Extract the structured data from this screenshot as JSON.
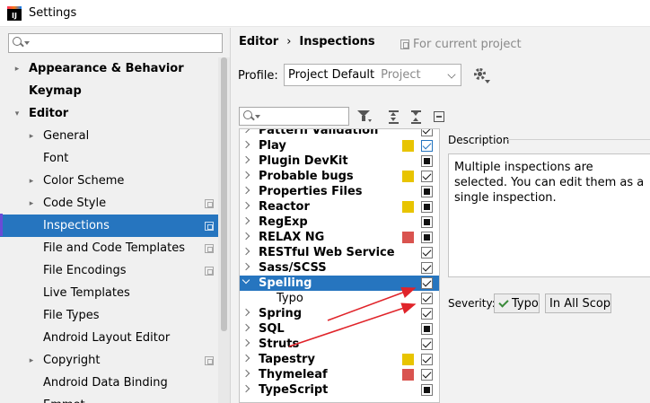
{
  "window": {
    "title": "Settings"
  },
  "sidebar": {
    "items": [
      {
        "label": "Appearance & Behavior",
        "arrow": "▸",
        "bold": true,
        "indent": 0,
        "proj": false,
        "selected": false
      },
      {
        "label": "Keymap",
        "arrow": "",
        "bold": true,
        "indent": 0,
        "proj": false,
        "selected": false
      },
      {
        "label": "Editor",
        "arrow": "▾",
        "bold": true,
        "indent": 0,
        "proj": false,
        "selected": false
      },
      {
        "label": "General",
        "arrow": "▸",
        "bold": false,
        "indent": 1,
        "proj": false,
        "selected": false
      },
      {
        "label": "Font",
        "arrow": "",
        "bold": false,
        "indent": 1,
        "proj": false,
        "selected": false
      },
      {
        "label": "Color Scheme",
        "arrow": "▸",
        "bold": false,
        "indent": 1,
        "proj": false,
        "selected": false
      },
      {
        "label": "Code Style",
        "arrow": "▸",
        "bold": false,
        "indent": 1,
        "proj": true,
        "selected": false
      },
      {
        "label": "Inspections",
        "arrow": "",
        "bold": false,
        "indent": 1,
        "proj": true,
        "selected": true
      },
      {
        "label": "File and Code Templates",
        "arrow": "",
        "bold": false,
        "indent": 1,
        "proj": true,
        "selected": false
      },
      {
        "label": "File Encodings",
        "arrow": "",
        "bold": false,
        "indent": 1,
        "proj": true,
        "selected": false
      },
      {
        "label": "Live Templates",
        "arrow": "",
        "bold": false,
        "indent": 1,
        "proj": false,
        "selected": false
      },
      {
        "label": "File Types",
        "arrow": "",
        "bold": false,
        "indent": 1,
        "proj": false,
        "selected": false
      },
      {
        "label": "Android Layout Editor",
        "arrow": "",
        "bold": false,
        "indent": 1,
        "proj": false,
        "selected": false
      },
      {
        "label": "Copyright",
        "arrow": "▸",
        "bold": false,
        "indent": 1,
        "proj": true,
        "selected": false
      },
      {
        "label": "Android Data Binding",
        "arrow": "",
        "bold": false,
        "indent": 1,
        "proj": false,
        "selected": false
      },
      {
        "label": "Emmet",
        "arrow": "▸",
        "bold": false,
        "indent": 1,
        "proj": false,
        "selected": false
      }
    ]
  },
  "breadcrumb": {
    "part1": "Editor",
    "separator": "›",
    "part2": "Inspections"
  },
  "for_project": "For current project",
  "profile": {
    "label": "Profile:",
    "value": "Project Default",
    "secondary": "Project"
  },
  "inspections": [
    {
      "name": "Pattern Validation",
      "swatch": "",
      "check": "checked",
      "child": false,
      "selected": false,
      "open": false
    },
    {
      "name": "Play",
      "swatch": "#e8c400",
      "check": "checked-blue",
      "child": false,
      "selected": false,
      "open": false
    },
    {
      "name": "Plugin DevKit",
      "swatch": "",
      "check": "mixed",
      "child": false,
      "selected": false,
      "open": false
    },
    {
      "name": "Probable bugs",
      "swatch": "#e8c400",
      "check": "checked",
      "child": false,
      "selected": false,
      "open": false
    },
    {
      "name": "Properties Files",
      "swatch": "",
      "check": "mixed",
      "child": false,
      "selected": false,
      "open": false
    },
    {
      "name": "Reactor",
      "swatch": "#e8c400",
      "check": "mixed",
      "child": false,
      "selected": false,
      "open": false
    },
    {
      "name": "RegExp",
      "swatch": "",
      "check": "mixed",
      "child": false,
      "selected": false,
      "open": false
    },
    {
      "name": "RELAX NG",
      "swatch": "#d9534f",
      "check": "mixed",
      "child": false,
      "selected": false,
      "open": false
    },
    {
      "name": "RESTful Web Service",
      "swatch": "",
      "check": "checked",
      "child": false,
      "selected": false,
      "open": false
    },
    {
      "name": "Sass/SCSS",
      "swatch": "",
      "check": "checked",
      "child": false,
      "selected": false,
      "open": false
    },
    {
      "name": "Spelling",
      "swatch": "",
      "check": "checked",
      "child": false,
      "selected": true,
      "open": true
    },
    {
      "name": "Typo",
      "swatch": "",
      "check": "checked",
      "child": true,
      "selected": false,
      "open": false
    },
    {
      "name": "Spring",
      "swatch": "",
      "check": "checked",
      "child": false,
      "selected": false,
      "open": false
    },
    {
      "name": "SQL",
      "swatch": "",
      "check": "mixed",
      "child": false,
      "selected": false,
      "open": false
    },
    {
      "name": "Struts",
      "swatch": "",
      "check": "checked",
      "child": false,
      "selected": false,
      "open": false
    },
    {
      "name": "Tapestry",
      "swatch": "#e8c400",
      "check": "checked",
      "child": false,
      "selected": false,
      "open": false
    },
    {
      "name": "Thymeleaf",
      "swatch": "#d9534f",
      "check": "checked",
      "child": false,
      "selected": false,
      "open": false
    },
    {
      "name": "TypeScript",
      "swatch": "",
      "check": "mixed",
      "child": false,
      "selected": false,
      "open": false
    }
  ],
  "description": {
    "label": "Description",
    "text": "Multiple inspections are selected. You can edit them as a single inspection."
  },
  "severity": {
    "label": "Severity:",
    "value": "Typo",
    "scope": "In All Scopes"
  },
  "colors": {
    "selection": "#2675bf",
    "warning_swatch": "#e8c400",
    "error_swatch": "#d9534f",
    "annotation": "#e0242a"
  }
}
